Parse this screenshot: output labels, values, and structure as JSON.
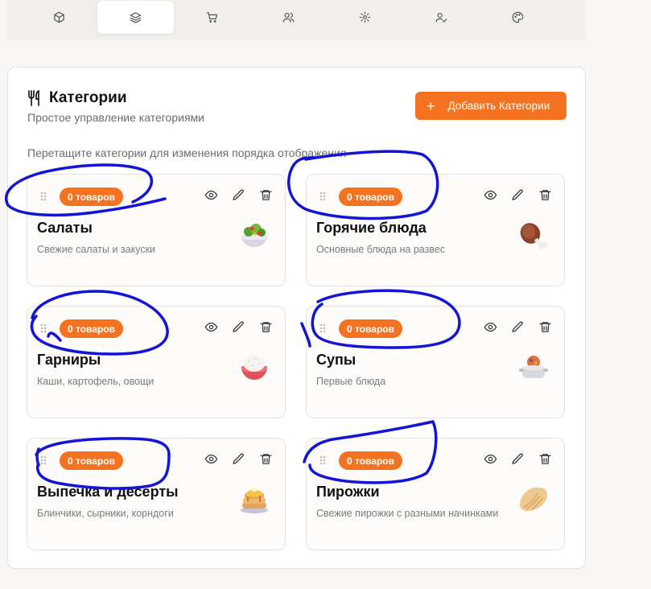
{
  "nav": {
    "tabs": [
      {
        "icon": "box-icon",
        "active": false
      },
      {
        "icon": "layers-icon",
        "active": true
      },
      {
        "icon": "cart-icon",
        "active": false
      },
      {
        "icon": "users-icon",
        "active": false
      },
      {
        "icon": "gear-icon",
        "active": false
      },
      {
        "icon": "user-check-icon",
        "active": false
      },
      {
        "icon": "palette-icon",
        "active": false
      }
    ]
  },
  "header": {
    "title": "Категории",
    "subtitle": "Простое управление категориями",
    "add_button_label": "Добавить Категории",
    "hint": "Перетащите категории для изменения порядка отображения"
  },
  "categories": [
    {
      "badge": "0 товаров",
      "name": "Салаты",
      "description": "Свежие салаты и закуски",
      "image": "salad-bowl"
    },
    {
      "badge": "0 товаров",
      "name": "Горячие блюда",
      "description": "Основные блюда на развес",
      "image": "meat-leg"
    },
    {
      "badge": "0 товаров",
      "name": "Гарниры",
      "description": "Каши, картофель, овощи",
      "image": "rice-bowl"
    },
    {
      "badge": "0 товаров",
      "name": "Супы",
      "description": "Первые блюда",
      "image": "soup-pot"
    },
    {
      "badge": "0 товаров",
      "name": "Выпечка и десерты",
      "description": "Блинчики, сырники, корндоги",
      "image": "pancakes"
    },
    {
      "badge": "0 товаров",
      "name": "Пирожки",
      "description": "Свежие пирожки с разными начинками",
      "image": "dumpling"
    }
  ],
  "colors": {
    "accent": "#f57320",
    "annotation": "#1414d6"
  }
}
